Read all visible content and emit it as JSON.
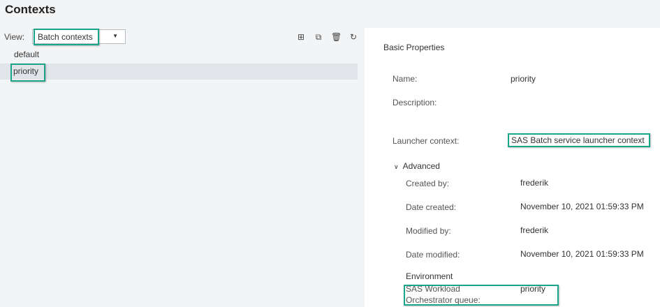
{
  "page_title": "Contexts",
  "left": {
    "view_label": "View:",
    "view_value": "Batch contexts",
    "icons": [
      "new-icon",
      "copy-icon",
      "delete-icon",
      "refresh-icon"
    ],
    "items": [
      {
        "label": "default"
      },
      {
        "label": "priority",
        "selected": true
      }
    ]
  },
  "right": {
    "section": "Basic Properties",
    "name_label": "Name:",
    "name_value": "priority",
    "description_label": "Description:",
    "launcher_label": "Launcher context:",
    "launcher_value": "SAS Batch service launcher context",
    "advanced": "Advanced",
    "created_by_label": "Created by:",
    "created_by": "frederik",
    "date_created_label": "Date created:",
    "date_created": "November 10, 2021 01:59:33 PM",
    "modified_by_label": "Modified by:",
    "modified_by": "frederik",
    "date_modified_label": "Date modified:",
    "date_modified": "November 10, 2021 01:59:33 PM",
    "environment": "Environment",
    "queue_label_1": "SAS Workload",
    "queue_label_2": "Orchestrator queue:",
    "queue_value": "priority"
  },
  "colors": {
    "highlight": "#1aa58a",
    "selected_row": "#e1e4e9"
  }
}
